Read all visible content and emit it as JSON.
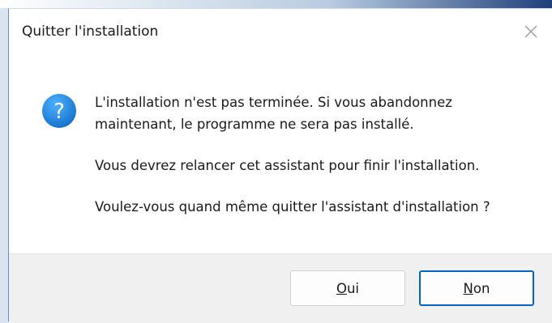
{
  "dialog": {
    "title": "Quitter l'installation",
    "close_icon": "close-icon",
    "icon": "question-icon",
    "accent_color": "#0067c0",
    "icon_color": "#1e88d8",
    "paragraphs": {
      "p1_line1": "L'installation n'est pas terminée. Si vous abandonnez",
      "p1_line2": "maintenant, le programme ne sera pas installé.",
      "p2": "Vous devrez relancer cet assistant pour finir l'installation.",
      "p3": "Voulez-vous quand même quitter l'assistant d'installation ?"
    },
    "buttons": {
      "yes": {
        "accel": "O",
        "rest": "ui"
      },
      "no": {
        "accel": "N",
        "rest": "on",
        "default": true
      }
    }
  }
}
